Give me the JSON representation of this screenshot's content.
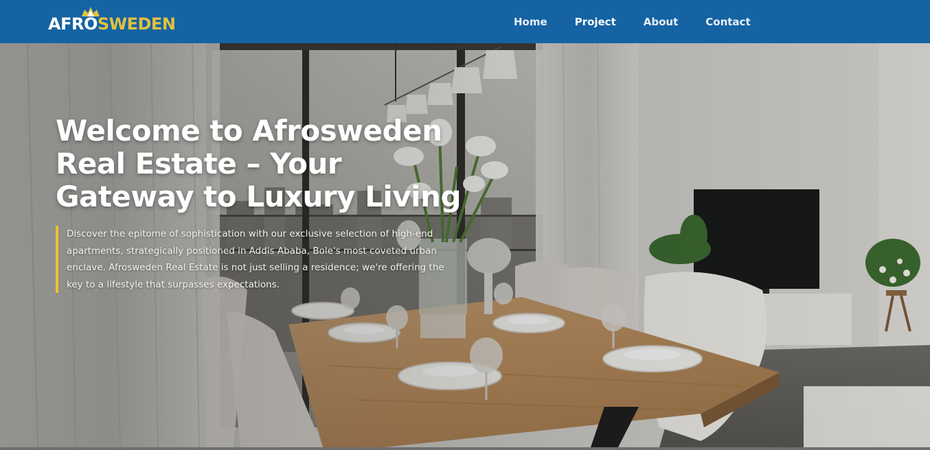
{
  "brand": {
    "logo_afro": "AFRO",
    "logo_sweden": "SWEDEN"
  },
  "nav": {
    "items": [
      {
        "label": "Home"
      },
      {
        "label": "Project"
      },
      {
        "label": "About"
      },
      {
        "label": "Contact"
      }
    ]
  },
  "hero": {
    "title": "Welcome to Afrosweden Real Estate – Your Gateway to Luxury Living",
    "description": "Discover the epitome of sophistication with our exclusive selection of high-end apartments, strategically positioned in Addis Ababa, Bole's most coveted urban enclave. Afrosweden Real Estate is not just selling a residence; we're offering the key to a lifestyle that surpasses expectations."
  },
  "colors": {
    "header_bg": "#1563a3",
    "accent_gold": "#e1c13f",
    "quote_bar": "#f2c12e",
    "text_white": "#ffffff"
  }
}
